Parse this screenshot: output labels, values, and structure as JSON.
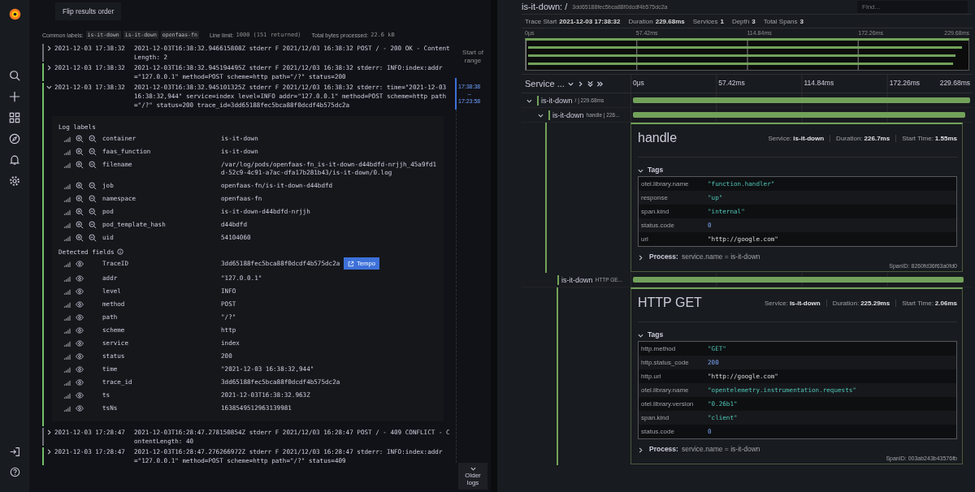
{
  "logs_panel": {
    "flip_button": "Flip results order",
    "common_labels_label": "Common labels:",
    "common_labels": [
      "is-it-down",
      "is-it-down",
      "openfaas-fn"
    ],
    "line_limit_label": "Line limit:",
    "line_limit": "1000 (151 returned)",
    "bytes_label": "Total bytes processed:",
    "bytes": "22.6 kB",
    "logs": [
      {
        "time": "2021-12-03 17:38:32",
        "message": "2021-12-03T16:38:32.946615808Z stderr F 2021/12/03 16:38:32 POST / - 200 OK - ContentLength: 2",
        "color": "#6e7079",
        "expanded": false
      },
      {
        "time": "2021-12-03 17:38:32",
        "message": "2021-12-03T16:38:32.945194495Z stderr F 2021/12/03 16:38:32 stderr: INFO:index:addr=\"127.0.0.1\" method=POST scheme=http path=\"/?\" status=200",
        "color": "#73bf69",
        "expanded": false
      },
      {
        "time": "2021-12-03 17:38:32",
        "message": "2021-12-03T16:38:32.945101325Z stderr F 2021/12/03 16:38:32 stderr: time=\"2021-12-03 16:38:32,944\" service=index level=INFO addr=\"127.0.0.1\" method=POST scheme=http path=\"/?\" status=200 trace_id=3dd65188fec5bca88f0dcdf4b575dc2a",
        "color": "#73bf69",
        "expanded": true,
        "details": {
          "labels_title": "Log labels",
          "labels": [
            {
              "name": "container",
              "value": "is-it-down"
            },
            {
              "name": "faas_function",
              "value": "is-it-down"
            },
            {
              "name": "filename",
              "value": "/var/log/pods/openfaas-fn_is-it-down-d44bdfd-nrjjh_45a9fd1d-52c9-4c91-a7ac-dfa17b281b43/is-it-down/0.log"
            },
            {
              "name": "job",
              "value": "openfaas-fn/is-it-down-d44bdfd"
            },
            {
              "name": "namespace",
              "value": "openfaas-fn"
            },
            {
              "name": "pod",
              "value": "is-it-down-d44bdfd-nrjjh"
            },
            {
              "name": "pod_template_hash",
              "value": "d44bdfd"
            },
            {
              "name": "uid",
              "value": "54104060"
            }
          ],
          "fields_title": "Detected fields",
          "fields": [
            {
              "name": "TraceID",
              "value": "3dd65188fec5bca88f0dcdf4b575dc2a",
              "link": "Tempo"
            },
            {
              "name": "addr",
              "value": "\"127.0.0.1\""
            },
            {
              "name": "level",
              "value": "INFO"
            },
            {
              "name": "method",
              "value": "POST"
            },
            {
              "name": "path",
              "value": "\"/?\""
            },
            {
              "name": "scheme",
              "value": "http"
            },
            {
              "name": "service",
              "value": "index"
            },
            {
              "name": "status",
              "value": "200"
            },
            {
              "name": "time",
              "value": "\"2021-12-03 16:38:32,944\""
            },
            {
              "name": "trace_id",
              "value": "3dd65188fec5bca88f0dcdf4b575dc2a"
            },
            {
              "name": "ts",
              "value": "2021-12-03T16:38:32.963Z"
            },
            {
              "name": "tsNs",
              "value": "1638549512963139981"
            }
          ]
        }
      },
      {
        "time": "2021-12-03 17:28:47",
        "message": "2021-12-03T16:28:47.278150854Z stderr F 2021/12/03 16:28:47 POST / - 409 CONFLICT - ContentLength: 40",
        "color": "#6e7079",
        "expanded": false
      },
      {
        "time": "2021-12-03 17:28:47",
        "message": "2021-12-03T16:28:47.276266972Z stderr F 2021/12/03 16:28:47 stderr: INFO:index:addr=\"127.0.0.1\" method=POST scheme=http path=\"/?\" status=409",
        "color": "#73bf69",
        "expanded": false
      }
    ],
    "range": {
      "start_label": "Start of range",
      "from": "17:38:38",
      "separator": "–",
      "to": "17:23:58",
      "older_button": "Older logs"
    }
  },
  "trace": {
    "title": "is-it-down: /",
    "trace_id": "3dd65188fec5bca88f0dcdf4b575dc2a",
    "find_placeholder": "Find...",
    "stats": [
      {
        "label": "Trace Start",
        "value": "2021-12-03 17:38:32"
      },
      {
        "label": "Duration",
        "value": "229.68ms"
      },
      {
        "label": "Services",
        "value": "1"
      },
      {
        "label": "Depth",
        "value": "3"
      },
      {
        "label": "Total Spans",
        "value": "3"
      }
    ],
    "minimap_ticks": [
      "0μs",
      "57.42ms",
      "114.84ms",
      "172.26ms",
      "229.68ms"
    ],
    "column_title": "Service ...",
    "ticks": [
      "0μs",
      "57.42ms",
      "114.84ms",
      "172.26ms",
      "229.68ms"
    ],
    "spans": [
      {
        "service": "is-it-down",
        "operation": "/ | 229.68ms",
        "level": 1,
        "expanded": true,
        "children": [
          {
            "service": "is-it-down",
            "operation": "handle | 226...",
            "level": 0.985,
            "expanded": true,
            "detail": {
              "title": "handle",
              "service_label": "Service:",
              "service": "is-it-down",
              "duration_label": "Duration:",
              "duration": "226.7ms",
              "start_label": "Start Time:",
              "start": "1.55ms",
              "tags_title": "Tags",
              "tags": [
                {
                  "key": "otel.library.name",
                  "value": "\"function.handler\"",
                  "kind": "string"
                },
                {
                  "key": "response",
                  "value": "\"up\"",
                  "kind": "string"
                },
                {
                  "key": "span.kind",
                  "value": "\"internal\"",
                  "kind": "string"
                },
                {
                  "key": "status.code",
                  "value": "0",
                  "kind": "number"
                },
                {
                  "key": "url",
                  "value": "\"http://google.com\"",
                  "kind": "url"
                }
              ],
              "process_label": "Process:",
              "process": "service.name = is-it-down",
              "span_id": "SpanID: 8260fd36f63a0fd0"
            },
            "children": [
              {
                "service": "is-it-down",
                "operation": "HTTP GE...",
                "level": 0.98,
                "detail": {
                  "title": "HTTP GET",
                  "service_label": "Service:",
                  "service": "is-it-down",
                  "duration_label": "Duration:",
                  "duration": "225.29ms",
                  "start_label": "Start Time:",
                  "start": "2.06ms",
                  "tags_title": "Tags",
                  "tags": [
                    {
                      "key": "http.method",
                      "value": "\"GET\"",
                      "kind": "string"
                    },
                    {
                      "key": "http.status_code",
                      "value": "200",
                      "kind": "number"
                    },
                    {
                      "key": "http.url",
                      "value": "\"http://google.com\"",
                      "kind": "url"
                    },
                    {
                      "key": "otel.library.name",
                      "value": "\"opentelemetry.instrumentation.requests\"",
                      "kind": "string"
                    },
                    {
                      "key": "otel.library.version",
                      "value": "\"0.26b1\"",
                      "kind": "string"
                    },
                    {
                      "key": "span.kind",
                      "value": "\"client\"",
                      "kind": "string"
                    },
                    {
                      "key": "status.code",
                      "value": "0",
                      "kind": "number"
                    }
                  ],
                  "process_label": "Process:",
                  "process": "service.name = is-it-down",
                  "span_id": "SpanID: 003ab243b43576fb"
                }
              }
            ]
          }
        ]
      }
    ]
  }
}
